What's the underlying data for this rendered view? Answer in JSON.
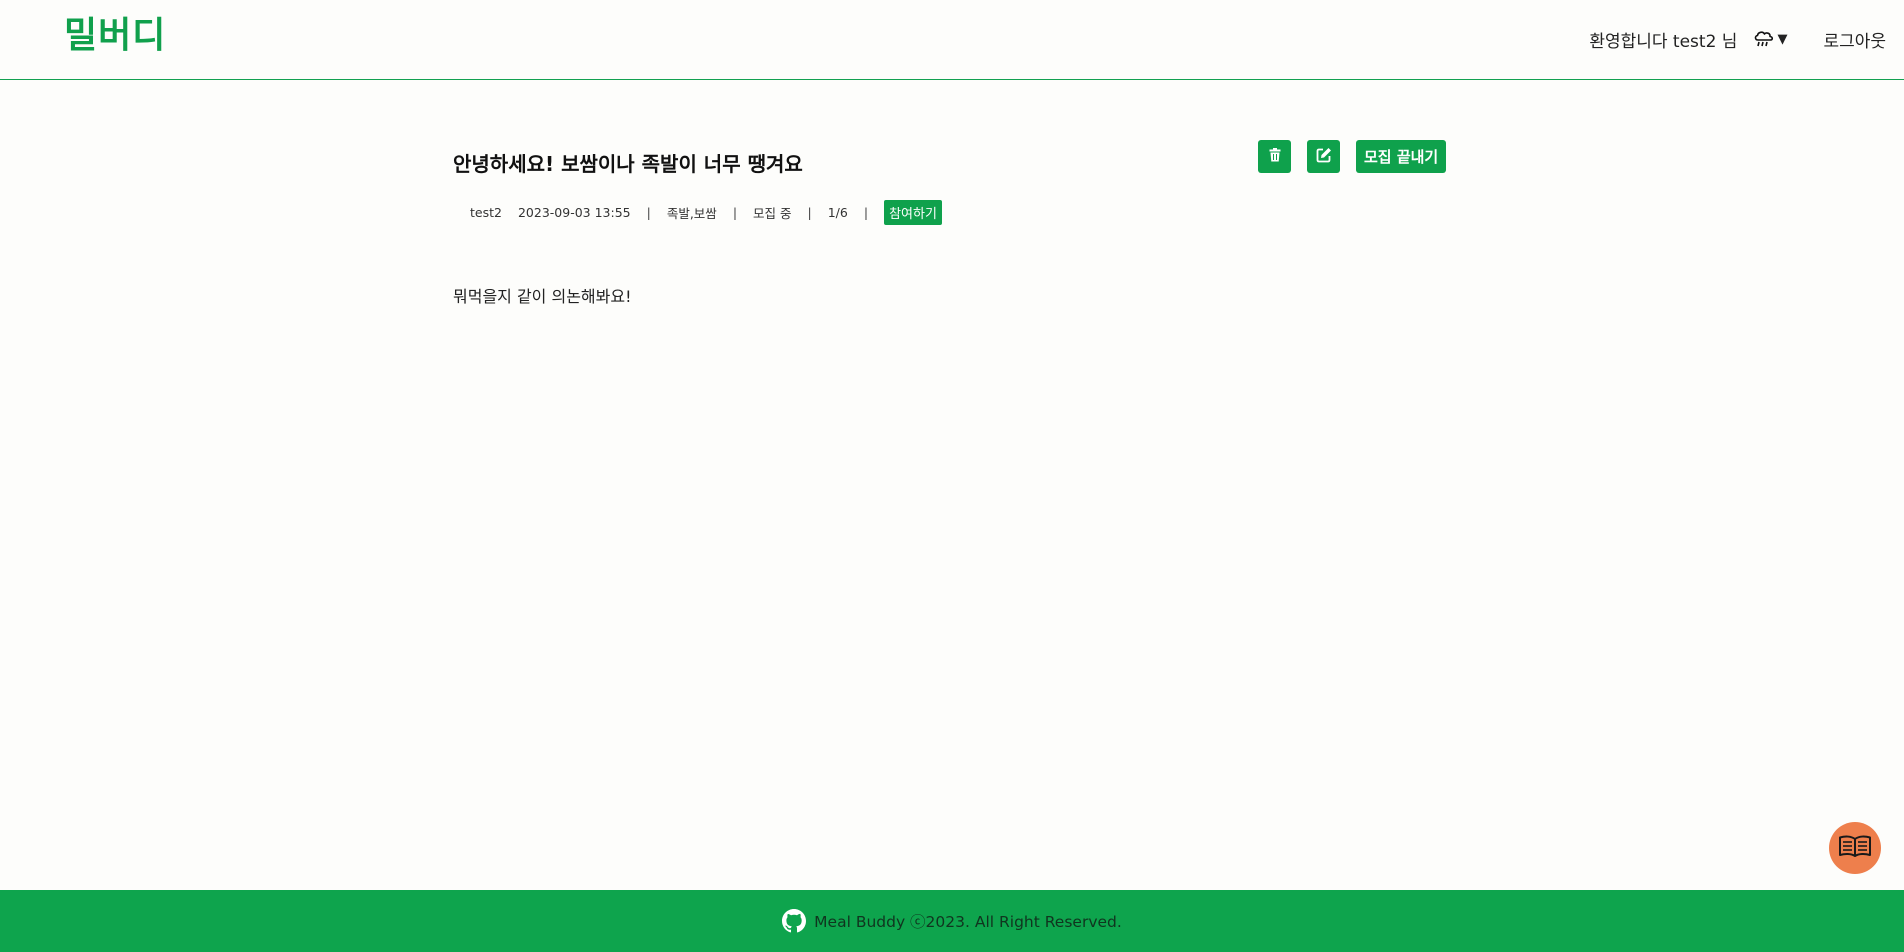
{
  "header": {
    "logo": "밀버디",
    "welcome": "환영합니다 test2 님",
    "weather_icon": "rain-cloud-icon",
    "logout": "로그아웃"
  },
  "post": {
    "title": "안녕하세요! 보쌈이나 족발이 너무 땡겨요",
    "author": "test2",
    "date": "2023-09-03 13:55",
    "menu": "족발,보쌈",
    "status": "모집 중",
    "participants": "1/6",
    "join_label": "참여하기",
    "body": "뭐먹을지 같이 의논해봐요!",
    "actions": {
      "delete_icon": "trash-icon",
      "edit_icon": "edit-icon",
      "close_label": "모집 끝내기"
    }
  },
  "footer": {
    "text": "Meal Buddy ⓒ2023. All Right Reserved.",
    "icon": "github-icon"
  },
  "colors": {
    "accent": "#0fa14c",
    "guide_button": "#ee7f4c"
  }
}
